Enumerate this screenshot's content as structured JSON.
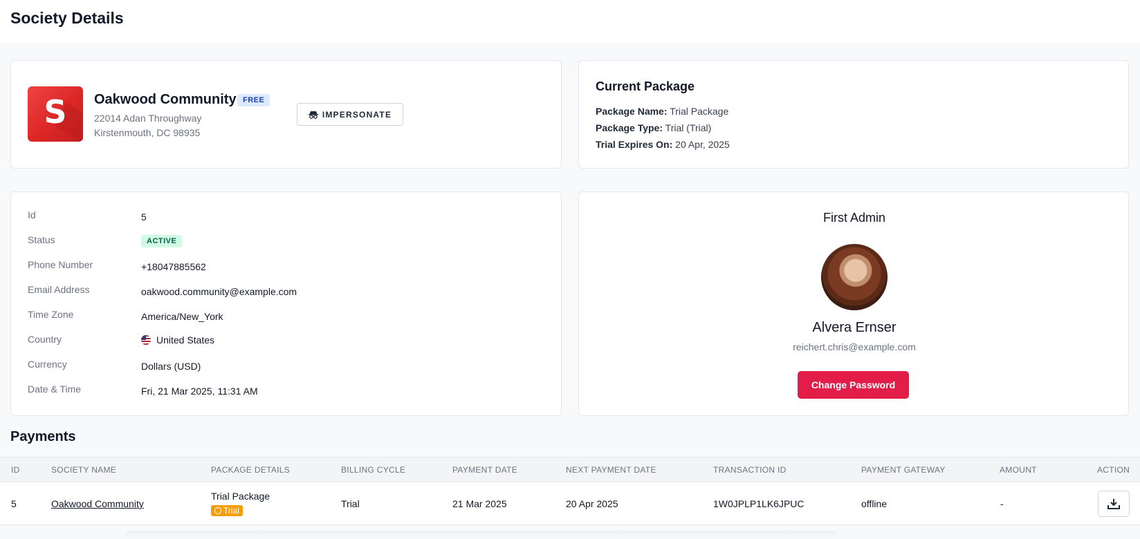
{
  "page": {
    "title": "Society Details"
  },
  "society": {
    "logo_letter": "S",
    "name": "Oakwood Community",
    "plan_badge": "FREE",
    "address_line1": "22014 Adan Throughway",
    "address_line2": "Kirstenmouth, DC 98935",
    "impersonate_label": "IMPERSONATE"
  },
  "package": {
    "title": "Current Package",
    "name_label": "Package Name:",
    "name_value": "Trial Package",
    "type_label": "Package Type:",
    "type_value": "Trial (Trial)",
    "expires_label": "Trial Expires On:",
    "expires_value": "20 Apr, 2025"
  },
  "details": {
    "id_label": "Id",
    "id_value": "5",
    "status_label": "Status",
    "status_value": "ACTIVE",
    "phone_label": "Phone Number",
    "phone_value": "+18047885562",
    "email_label": "Email Address",
    "email_value": "oakwood.community@example.com",
    "timezone_label": "Time Zone",
    "timezone_value": "America/New_York",
    "country_label": "Country",
    "country_value": "United States",
    "currency_label": "Currency",
    "currency_value": "Dollars (USD)",
    "datetime_label": "Date & Time",
    "datetime_value": "Fri, 21 Mar 2025, 11:31 AM"
  },
  "admin": {
    "title": "First Admin",
    "name": "Alvera Ernser",
    "email": "reichert.chris@example.com",
    "change_password_label": "Change Password"
  },
  "payments": {
    "title": "Payments",
    "columns": [
      "ID",
      "SOCIETY NAME",
      "PACKAGE DETAILS",
      "BILLING CYCLE",
      "PAYMENT DATE",
      "NEXT PAYMENT DATE",
      "TRANSACTION ID",
      "PAYMENT GATEWAY",
      "AMOUNT",
      "ACTION"
    ],
    "rows": [
      {
        "id": "5",
        "society_name": "Oakwood Community",
        "package_name": "Trial Package",
        "package_badge": "Trial",
        "billing_cycle": "Trial",
        "payment_date": "21 Mar 2025",
        "next_payment_date": "20 Apr 2025",
        "transaction_id": "1W0JPLP1LK6JPUC",
        "payment_gateway": "offline",
        "amount": "-"
      }
    ]
  }
}
